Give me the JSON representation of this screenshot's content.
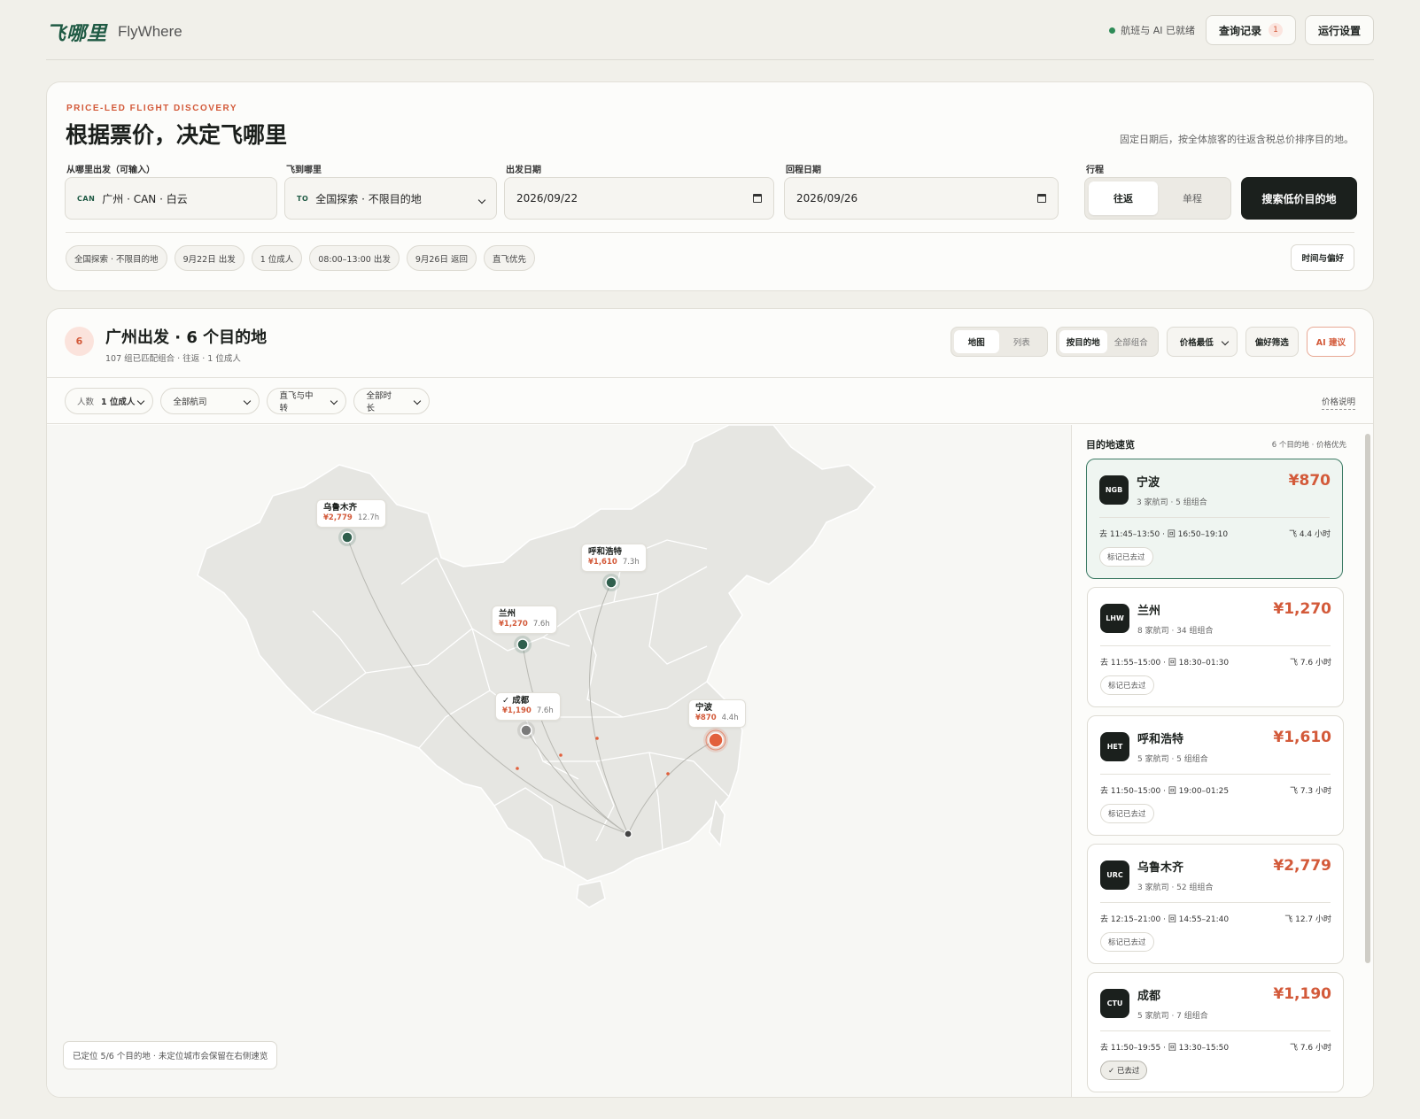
{
  "header": {
    "brand_cn": "飞哪里",
    "brand_en": "FlyWhere",
    "status": "航班与 AI 已就绪",
    "history_label": "查询记录",
    "history_count": "1",
    "settings_label": "运行设置"
  },
  "search": {
    "eyebrow": "PRICE-LED FLIGHT DISCOVERY",
    "title": "根据票价，决定飞哪里",
    "note": "固定日期后，按全体旅客的往返含税总价排序目的地。",
    "from_label": "从哪里出发（可输入）",
    "from_code": "CAN",
    "from_value": "广州 · CAN · 白云",
    "to_label": "飞到哪里",
    "to_code": "TO",
    "to_value": "全国探索 · 不限目的地",
    "depart_label": "出发日期",
    "depart_value": "2026/09/22",
    "return_label": "回程日期",
    "return_value": "2026/09/26",
    "trip_label": "行程",
    "trip_options": [
      "往返",
      "单程"
    ],
    "submit_label": "搜索低价目的地",
    "chips": [
      "全国探索 · 不限目的地",
      "9月22日 出发",
      "1 位成人",
      "08:00–13:00 出发",
      "9月26日 返回",
      "直飞优先"
    ],
    "pref_label": "时间与偏好"
  },
  "results": {
    "count": "6",
    "title": "广州出发 · 6 个目的地",
    "subtitle": "107 组已匹配组合 · 往返 · 1 位成人",
    "view_options": [
      "地图",
      "列表"
    ],
    "group_options": [
      "按目的地",
      "全部组合"
    ],
    "sort_label": "价格最低",
    "pref_filter_label": "偏好筛选",
    "ai_label": "AI 建议",
    "filters": {
      "pax_label": "人数",
      "pax_value": "1 位成人",
      "airline": "全部航司",
      "stops": "直飞与中转",
      "duration": "全部时长"
    },
    "price_note": "价格说明"
  },
  "map": {
    "origin": "广州",
    "pins": [
      {
        "city": "乌鲁木齐",
        "price": "¥2,779",
        "duration": "12.7h"
      },
      {
        "city": "呼和浩特",
        "price": "¥1,610",
        "duration": "7.3h"
      },
      {
        "city": "兰州",
        "price": "¥1,270",
        "duration": "7.6h"
      },
      {
        "city": "✓ 成都",
        "price": "¥1,190",
        "duration": "7.6h"
      },
      {
        "city": "宁波",
        "price": "¥870",
        "duration": "4.4h"
      }
    ],
    "note": "已定位 5/6 个目的地 · 未定位城市会保留在右侧速览",
    "colors": {
      "land": "#e6e6e2",
      "border": "#ffffff",
      "pin": "#2f5f4d",
      "accent": "#e2603c",
      "route": "#b8b8b2"
    }
  },
  "side": {
    "title": "目的地速览",
    "meta": "6 个目的地 · 价格优先",
    "destinations": [
      {
        "iata": "NGB",
        "city": "宁波",
        "sub": "3 家航司 · 5 组组合",
        "price": "¥870",
        "times": "去 11:45–13:50 · 回 16:50–19:10",
        "fly": "飞 4.4 小时",
        "mark": "标记已去过"
      },
      {
        "iata": "LHW",
        "city": "兰州",
        "sub": "8 家航司 · 34 组组合",
        "price": "¥1,270",
        "times": "去 11:55–15:00 · 回 18:30–01:30",
        "fly": "飞 7.6 小时",
        "mark": "标记已去过"
      },
      {
        "iata": "HET",
        "city": "呼和浩特",
        "sub": "5 家航司 · 5 组组合",
        "price": "¥1,610",
        "times": "去 11:50–15:00 · 回 19:00–01:25",
        "fly": "飞 7.3 小时",
        "mark": "标记已去过"
      },
      {
        "iata": "URC",
        "city": "乌鲁木齐",
        "sub": "3 家航司 · 52 组组合",
        "price": "¥2,779",
        "times": "去 12:15–21:00 · 回 14:55–21:40",
        "fly": "飞 12.7 小时",
        "mark": "标记已去过"
      },
      {
        "iata": "CTU",
        "city": "成都",
        "sub": "5 家航司 · 7 组组合",
        "price": "¥1,190",
        "times": "去 11:50–19:55 · 回 13:30–15:50",
        "fly": "飞 7.6 小时",
        "mark": "✓ 已去过"
      }
    ]
  }
}
